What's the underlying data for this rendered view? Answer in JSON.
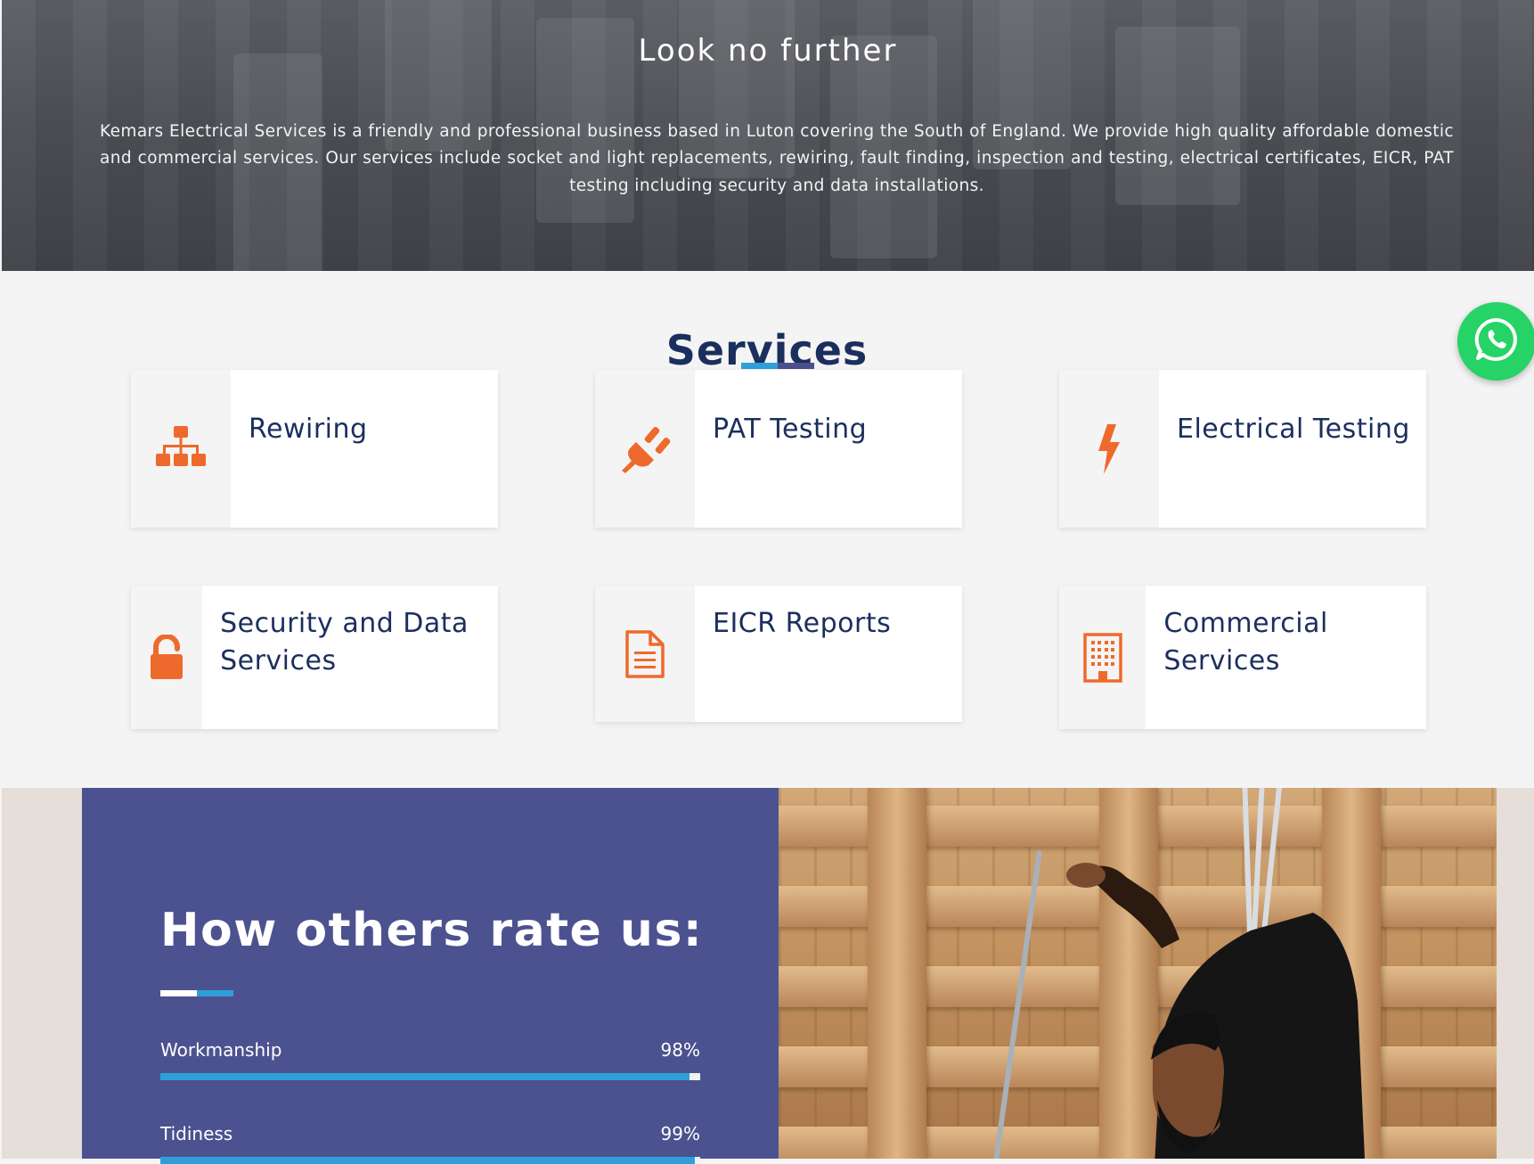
{
  "hero": {
    "title": "Look no further",
    "text": "Kemars Electrical Services is a friendly and professional business based in Luton covering the South of England. We provide high quality affordable domestic and commercial services. Our services include socket and light replacements, rewiring, fault finding, inspection and testing, electrical certificates, EICR, PAT testing including security and data installations."
  },
  "services": {
    "title": "Services",
    "accent_color": "#ee6a2c",
    "items": [
      {
        "label": "Rewiring",
        "icon": "sitemap-icon"
      },
      {
        "label": "PAT Testing",
        "icon": "plug-icon"
      },
      {
        "label": "Electrical Testing",
        "icon": "lightning-bolt-icon"
      },
      {
        "label": "Security and Data Services",
        "icon": "unlocked-padlock-icon"
      },
      {
        "label": "EICR Reports",
        "icon": "document-icon"
      },
      {
        "label": "Commercial Services",
        "icon": "building-icon"
      }
    ]
  },
  "whatsapp": {
    "icon": "whatsapp-icon",
    "color": "#25d366"
  },
  "ratings": {
    "title": "How others rate us:",
    "bar_color": "#2f9fda",
    "panel_color": "#4c528f",
    "metrics": [
      {
        "label": "Workmanship",
        "value": "98%",
        "fraction": 0.98
      },
      {
        "label": "Tidiness",
        "value": "99%",
        "fraction": 0.99
      }
    ]
  }
}
